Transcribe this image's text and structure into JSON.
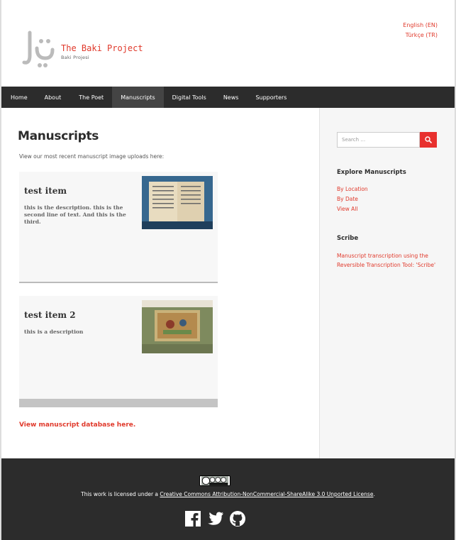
{
  "header": {
    "brand_title": "The Baki Project",
    "brand_subtitle": "Baki Projesi",
    "languages": [
      "English (EN)",
      "Türkçe (TR)"
    ]
  },
  "nav": {
    "items": [
      "Home",
      "About",
      "The Poet",
      "Manuscripts",
      "Digital Tools",
      "News",
      "Supporters"
    ],
    "active": "Manuscripts"
  },
  "main": {
    "title": "Manuscripts",
    "intro": "View our most recent manuscript image uploads here:",
    "items": [
      {
        "title": "test item",
        "description": "this is the description. this is the second line of text. And this is the third."
      },
      {
        "title": "test item 2",
        "description": "this is a description"
      }
    ],
    "database_link": "View manuscript database here."
  },
  "sidebar": {
    "search_placeholder": "Search …",
    "explore_heading": "Explore Manuscripts",
    "explore_links": [
      "By Location",
      "By Date",
      "View All"
    ],
    "scribe_heading": "Scribe",
    "scribe_text": "Manuscript transcription using the Reversible Transcription Tool: 'Scribe'"
  },
  "footer": {
    "license_prefix": "This work is licensed under a ",
    "license_link": "Creative Commons Attribution-NonCommercial-ShareAlike 3.0 Unported License",
    "license_suffix": ".",
    "social": [
      "facebook-icon",
      "twitter-icon",
      "github-icon"
    ]
  },
  "colors": {
    "accent": "#e0392b",
    "nav_bg": "#2c2c2c",
    "footer_bg": "#2c2c2c"
  }
}
